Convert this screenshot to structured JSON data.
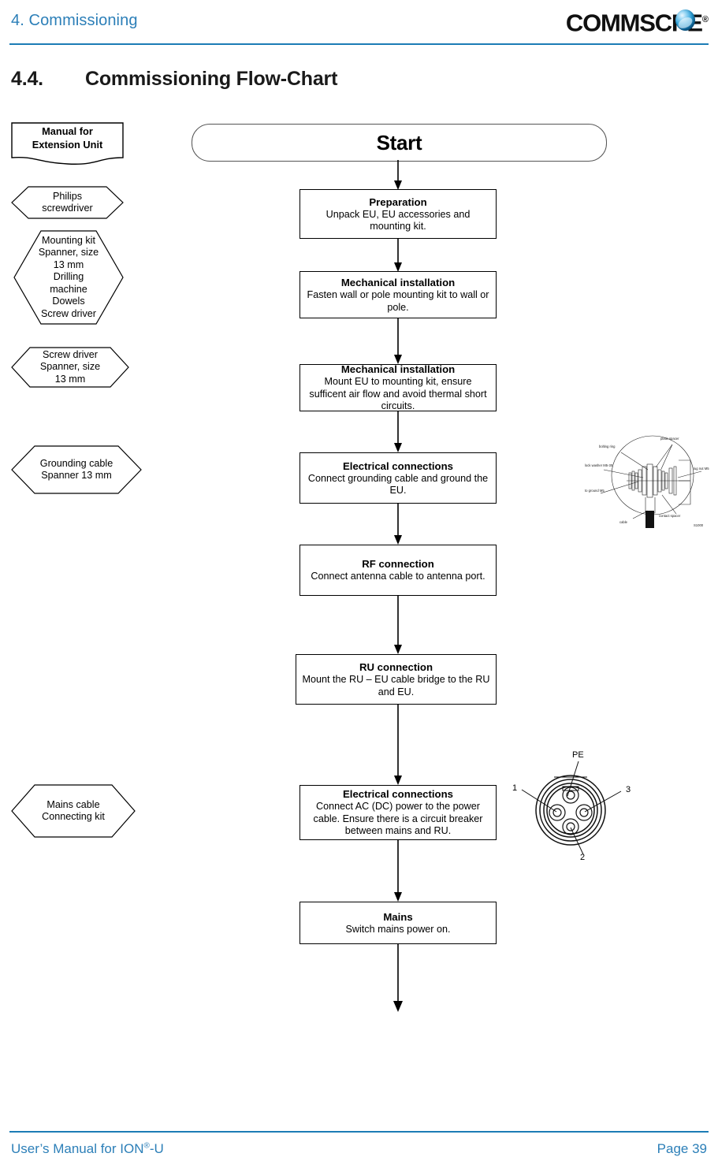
{
  "header": {
    "chapter": "4. Commissioning",
    "logo_text": "COMMSC",
    "logo_text_tail": "PE",
    "logo_registered": "®",
    "logo_icon": "commscope-sphere-icon"
  },
  "section": {
    "number": "4.4.",
    "title": "Commissioning Flow-Chart"
  },
  "flowchart": {
    "start_label": "Start",
    "steps": [
      {
        "id": "preparation",
        "title": "Preparation",
        "body": "Unpack EU, EU accessories and mounting kit."
      },
      {
        "id": "mechanical-installation-1",
        "title": "Mechanical installation",
        "body": "Fasten wall or pole mounting kit to wall or pole."
      },
      {
        "id": "mechanical-installation-2",
        "title": "Mechanical installation",
        "body": "Mount EU to mounting kit, ensure sufficent air flow and avoid thermal short circuits."
      },
      {
        "id": "electrical-connections-ground",
        "title": "Electrical connections",
        "body": "Connect grounding cable and ground the EU."
      },
      {
        "id": "rf-connection",
        "title": "RF connection",
        "body": "Connect antenna cable to antenna port."
      },
      {
        "id": "ru-connection",
        "title": "RU connection",
        "body": "Mount the RU – EU cable bridge to the RU and EU."
      },
      {
        "id": "electrical-connections-power",
        "title": "Electrical connections",
        "body": "Connect AC (DC) power to the power cable. Ensure there is a circuit breaker between mains and RU."
      },
      {
        "id": "mains",
        "title": "Mains",
        "body": "Switch mains power on."
      }
    ]
  },
  "resources": {
    "manual": {
      "line1": "Manual  for",
      "line2": "Extension Unit"
    },
    "items": [
      {
        "id": "philips-screwdriver",
        "lines": [
          "Philips",
          "screwdriver"
        ]
      },
      {
        "id": "mounting-kit",
        "lines": [
          "Mounting kit",
          "Spanner, size",
          "13 mm",
          "Drilling",
          "machine",
          "Dowels",
          "Screw driver"
        ]
      },
      {
        "id": "screw-driver-spanner",
        "lines": [
          "Screw driver",
          "Spanner, size",
          "13 mm"
        ]
      },
      {
        "id": "grounding-cable",
        "lines": [
          "Grounding cable",
          "Spanner 13 mm"
        ]
      },
      {
        "id": "mains-cable",
        "lines": [
          "Mains cable",
          "Connecting kit"
        ]
      }
    ]
  },
  "figures": {
    "grounding_assembly": {
      "name": "grounding-cable-assembly-figure",
      "labels": [
        "bolting ring",
        "lock washer M5-30",
        "to ground M5",
        "platic spacer",
        "lug nut M5",
        "contact spacer",
        "cable"
      ],
      "code": "S1000"
    },
    "power_connector": {
      "name": "power-connector-pinout-figure",
      "pin_pe": "PE",
      "pin_1": "1",
      "pin_2": "2",
      "pin_3": "3"
    }
  },
  "footer": {
    "left_pre": "User’s Manual for ION",
    "left_sup": "®",
    "left_post": "-U",
    "right": "Page 39"
  },
  "colors": {
    "brand_blue": "#2C7FB8",
    "rule_blue": "#1C7CB5",
    "ink": "#000000"
  }
}
